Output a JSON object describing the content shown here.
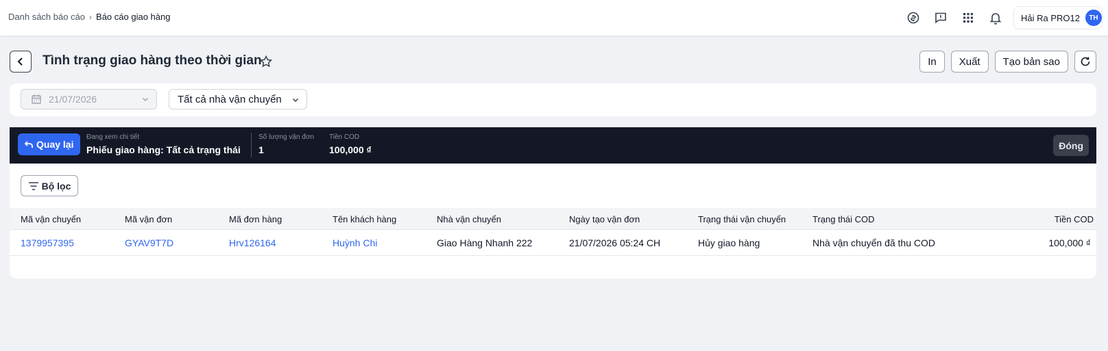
{
  "breadcrumb": {
    "parent": "Danh sách báo cáo",
    "separator": "›",
    "current": "Báo cáo giao hàng"
  },
  "topbar": {
    "icons": [
      "currency-exchange-icon",
      "feedback-icon",
      "apps-grid-icon",
      "bell-icon"
    ],
    "user_name": "Hải Ra PRO12",
    "avatar_initials": "TH"
  },
  "page": {
    "title": "Tình trạng giao hàng theo thời gian",
    "actions": {
      "print": "In",
      "export": "Xuất",
      "duplicate": "Tạo bản sao"
    }
  },
  "filters": {
    "date": "21/07/2026",
    "carrier": "Tất cả nhà vận chuyển"
  },
  "detail": {
    "back_label": "Quay lại",
    "viewing_label": "Đang xem chi tiết",
    "viewing_value": "Phiếu giao hàng: Tất cả trạng thái",
    "count_label": "Số lượng vận đơn",
    "count_value": "1",
    "cod_label": "Tiền COD",
    "cod_value": "100,000 ₫",
    "close_label": "Đóng"
  },
  "table": {
    "filter_label": "Bộ lọc",
    "columns": [
      "Mã vận chuyển",
      "Mã vận đơn",
      "Mã đơn hàng",
      "Tên khách hàng",
      "Nhà vận chuyển",
      "Ngày tạo vận đơn",
      "Trạng thái vận chuyển",
      "Trạng thái COD",
      "Tiền COD"
    ],
    "rows": [
      [
        "1379957395",
        "GYAV9T7D",
        "Hrv126164",
        "Huỳnh Chi",
        "Giao Hàng Nhanh 222",
        "21/07/2026 05:24 CH",
        "Hủy giao hàng",
        "Nhà vận chuyển đã thu COD",
        "100,000 ₫"
      ]
    ]
  },
  "colors": {
    "accent": "#2f66f0",
    "detail_bg": "#141826",
    "page_bg": "#f1f2f5"
  }
}
